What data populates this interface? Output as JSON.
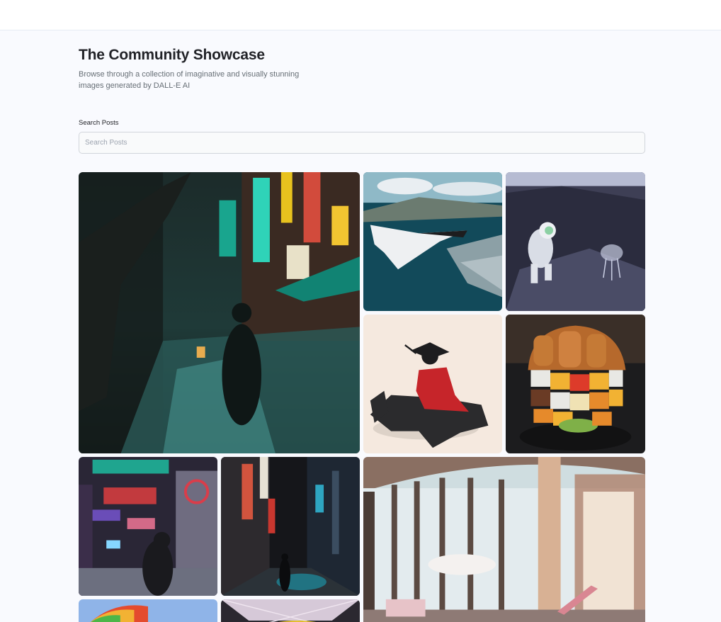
{
  "header": {
    "title": "The Community Showcase",
    "subtitle": "Browse through a collection of imaginative and visually stunning images generated by DALL-E AI"
  },
  "search": {
    "label": "Search Posts",
    "placeholder": "Search Posts",
    "value": ""
  },
  "colors": {
    "background": "#f9fafe",
    "title": "#222328",
    "subtitle": "#666e75"
  },
  "posts": [
    {
      "name": "neon-street-night-image"
    },
    {
      "name": "space-shuttle-coast-image"
    },
    {
      "name": "astronaut-jellyfish-image"
    },
    {
      "name": "samurai-horse-image"
    },
    {
      "name": "rubiks-burger-image"
    },
    {
      "name": "neon-alley-man-image"
    },
    {
      "name": "night-alley-image"
    },
    {
      "name": "glass-room-interior-image"
    },
    {
      "name": "rainbow-balloon-image"
    },
    {
      "name": "neon-ceiling-image"
    }
  ]
}
